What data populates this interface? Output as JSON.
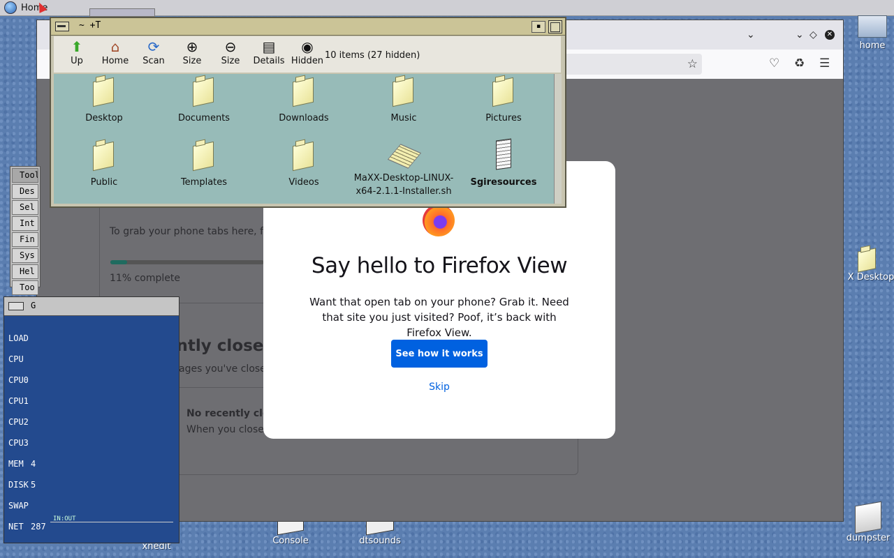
{
  "topbar": {
    "title": "Home"
  },
  "desktop": {
    "icons": {
      "home": "home",
      "maxx_desktop": "X Desktop",
      "xnedit": "xnedit",
      "console": "Console",
      "dtsounds": "dtsounds",
      "dumpster": "dumpster"
    }
  },
  "file_manager": {
    "title": "~ +T",
    "toolbar": {
      "up": "Up",
      "home": "Home",
      "scan": "Scan",
      "size_plus": "Size",
      "size_minus": "Size",
      "details": "Details",
      "hidden": "Hidden"
    },
    "item_count": "10 items (27 hidden)",
    "items": [
      "Desktop",
      "Documents",
      "Downloads",
      "Music",
      "Pictures",
      "Public",
      "Templates",
      "Videos",
      "MaXX-Desktop-LINUX-x64-2.1.1-Installer.sh",
      "Sgiresources"
    ]
  },
  "firefox": {
    "page": {
      "grab_tabs_text": "To grab your phone tabs here, f",
      "progress_fraction": 0.11,
      "progress_text": "11% complete",
      "recently_closed_title": "Recently closed",
      "recently_closed_sub": "Reopen pages you've close",
      "no_recent_title": "No recently clo",
      "no_recent_sub": "When you close"
    },
    "modal": {
      "title": "Say hello to Firefox View",
      "description": "Want that open tab on your phone? Grab it. Need that site you just visited? Poof, it’s back with Firefox View.",
      "primary_button": "See how it works",
      "skip": "Skip"
    }
  },
  "toolchest": {
    "title": "Tool",
    "items": [
      "Des",
      "Sel",
      "Int",
      "Fin",
      "Sys",
      "Hel",
      "Too"
    ]
  },
  "gmeter": {
    "title": "G",
    "rows": [
      {
        "label": "LOAD",
        "value": ""
      },
      {
        "label": "CPU",
        "value": ""
      },
      {
        "label": "CPU0",
        "value": ""
      },
      {
        "label": "CPU1",
        "value": ""
      },
      {
        "label": "CPU2",
        "value": ""
      },
      {
        "label": "CPU3",
        "value": ""
      },
      {
        "label": "MEM",
        "value": "4"
      },
      {
        "label": "DISK",
        "value": "5"
      },
      {
        "label": "SWAP",
        "value": ""
      },
      {
        "label": "NET",
        "value": "287"
      }
    ],
    "net_caption": "IN:OUT"
  },
  "colors": {
    "accent": "#0061e0",
    "fm_body": "#97bbb8",
    "desktop": "#5b7eb0"
  }
}
